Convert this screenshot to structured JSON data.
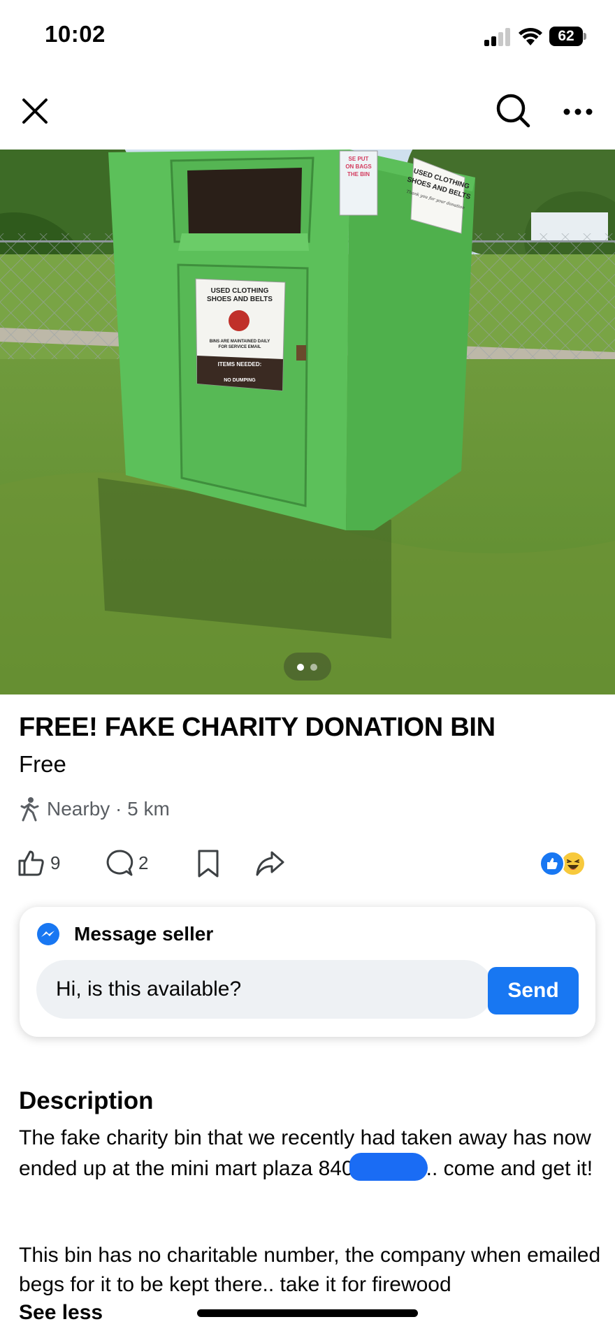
{
  "status_bar": {
    "time": "10:02",
    "battery": "62",
    "icons": [
      "signal-icon",
      "wifi-icon",
      "battery-icon"
    ]
  },
  "top_nav": {
    "icons": [
      "close-icon",
      "search-icon",
      "more-icon"
    ]
  },
  "photo": {
    "bin_color": "#5cc05a",
    "door_sign": {
      "line1": "USED CLOTHING",
      "line2": "SHOES AND BELTS",
      "line3": "BINS ARE MAINTAINED DAILY",
      "line4": "FOR SERVICE EMAIL",
      "line5": "ITEMS NEEDED:",
      "line6": "NO DUMPING"
    },
    "side_sign": {
      "line1": "USED CLOTHING",
      "line2": "SHOES AND BELTS",
      "line3": "Thank you for your donation"
    },
    "top_sign": {
      "line1": "SE PUT",
      "line2": "ON BAGS",
      "line3": "THE BIN"
    },
    "carousel": {
      "current": 1,
      "total": 2
    }
  },
  "listing": {
    "title": "FREE! FAKE CHARITY DONATION BIN",
    "price": "Free",
    "location": "Nearby · 5 km"
  },
  "actions": {
    "like_count": "9",
    "comment_count": "2",
    "reactions": [
      "like",
      "haha"
    ],
    "colors": {
      "accent": "#1877f2",
      "muted": "#5a5e63"
    }
  },
  "message_card": {
    "label": "Message seller",
    "input_value": "Hi, is this available?",
    "send_label": "Send"
  },
  "description": {
    "heading": "Description",
    "para1_before": "The fake charity bin that we recently had taken away has now ended up at the mini mart plaza 840",
    "para1_after": ".. come and get it!",
    "para2": "This bin has no charitable number, the company when emailed begs for it to be kept there.. take it for firewood",
    "see_less": "See less"
  }
}
